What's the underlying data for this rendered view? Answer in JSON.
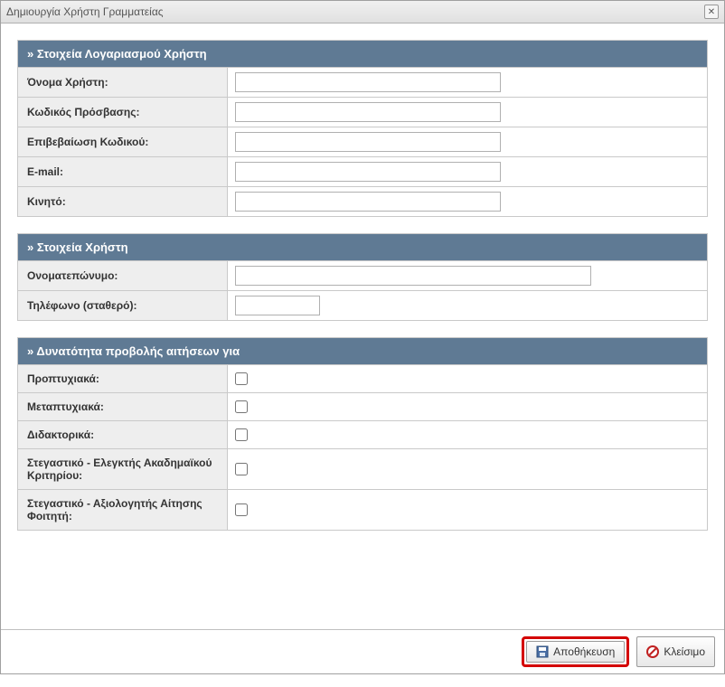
{
  "window": {
    "title": "Δημιουργία Χρήστη Γραμματείας"
  },
  "section_account": {
    "header": "» Στοιχεία Λογαριασμού Χρήστη",
    "username_label": "Όνομα Χρήστη:",
    "password_label": "Κωδικός Πρόσβασης:",
    "password_confirm_label": "Επιβεβαίωση Κωδικού:",
    "email_label": "E-mail:",
    "mobile_label": "Κινητό:"
  },
  "section_user": {
    "header": "» Στοιχεία Χρήστη",
    "fullname_label": "Ονοματεπώνυμο:",
    "phone_label": "Τηλέφωνο (σταθερό):"
  },
  "section_view": {
    "header": "» Δυνατότητα προβολής αιτήσεων για",
    "undergrad_label": "Προπτυχιακά:",
    "postgrad_label": "Μεταπτυχιακά:",
    "phd_label": "Διδακτορικά:",
    "housing_academic_label": "Στεγαστικό - Ελεγκτής Ακαδημαϊκού Κριτηρίου:",
    "housing_evaluator_label": "Στεγαστικό - Αξιολογητής Αίτησης Φοιτητή:"
  },
  "footer": {
    "save_label": "Αποθήκευση",
    "close_label": "Κλείσιμο"
  }
}
